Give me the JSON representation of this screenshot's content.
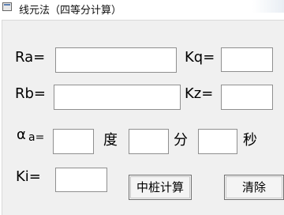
{
  "window": {
    "title": "线元法（四等分计算）"
  },
  "form": {
    "ra_label": "Ra=",
    "kq_label": "Kq=",
    "rb_label": "Rb=",
    "kz_label": "Kz=",
    "alpha_symbol": "α",
    "alpha_sub": "a=",
    "degree_label": "度",
    "minute_label": "分",
    "second_label": "秒",
    "ki_label": "Ki=",
    "ra_value": "",
    "kq_value": "",
    "rb_value": "",
    "kz_value": "",
    "deg_value": "",
    "min_value": "",
    "sec_value": "",
    "ki_value": ""
  },
  "buttons": {
    "calc_label": "中桩计算",
    "clear_label": "清除"
  }
}
